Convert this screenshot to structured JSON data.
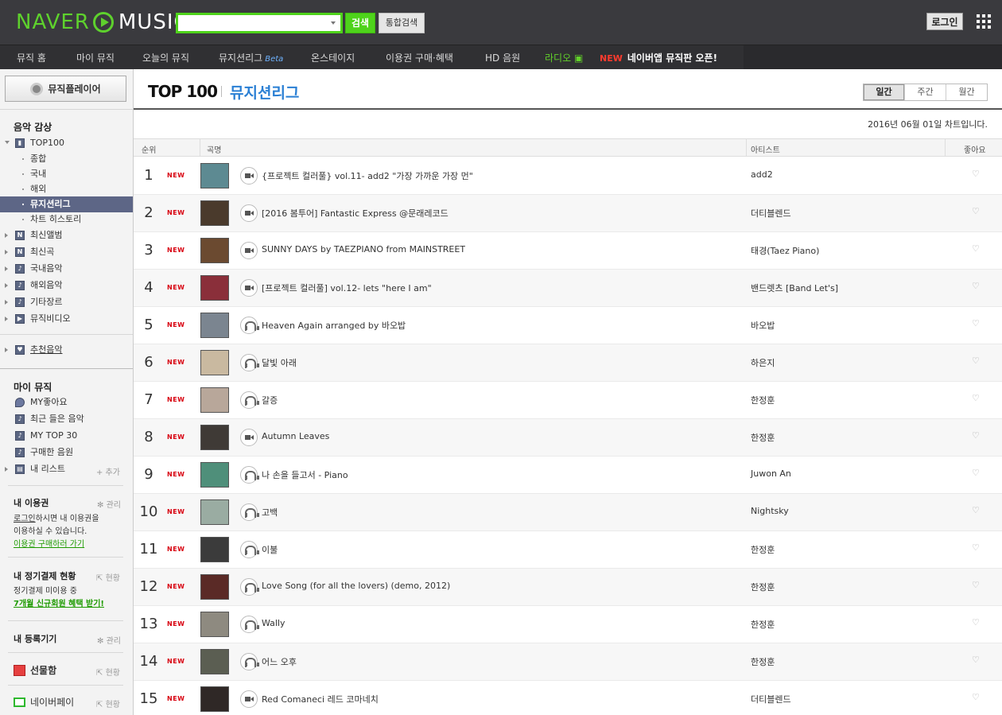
{
  "header": {
    "logo_left": "NAVER",
    "logo_right": "MUSIC",
    "search_placeholder": "",
    "search_button": "검색",
    "total_search_button": "통합검색",
    "login_button": "로그인"
  },
  "gnb": {
    "items": [
      "뮤직 홈",
      "마이 뮤직",
      "오늘의 뮤직",
      "뮤지션리그",
      "온스테이지",
      "이용권 구매·혜택",
      "HD 음원",
      "라디오"
    ],
    "beta": "Beta",
    "new_tag": "NEW",
    "notice": "네이버앱 뮤직판 오픈!"
  },
  "sidebar": {
    "player_button": "뮤직플레이어",
    "section_listen": "음악 감상",
    "top100": "TOP100",
    "top100_subs": [
      "종합",
      "국내",
      "해외",
      "뮤지션리그",
      "차트 히스토리"
    ],
    "menu": [
      "최신앨범",
      "최신곡",
      "국내음악",
      "해외음악",
      "기타장르",
      "뮤직비디오"
    ],
    "recommend": "추천음악",
    "section_my": "마이 뮤직",
    "my_items": [
      "MY좋아요",
      "최근 들은 음악",
      "MY TOP 30",
      "구매한 음원",
      "내 리스트"
    ],
    "add_label": "+ 추가",
    "my_pass_title": "내 이용권",
    "manage": "관리",
    "pass_text_login": "로그인",
    "pass_text_1": "하시면 내 이용권을",
    "pass_text_2": "이용하실 수 있습니다.",
    "pass_link": "이용권 구매하러 가기",
    "regular_title": "내 정기결제 현황",
    "status": "현황",
    "regular_text": "정기결제 미이용 중",
    "regular_link": "7개월 신규회원 혜택 받기!",
    "device_title": "내 등록기기",
    "gift": "선물함",
    "pay": "네이버페이"
  },
  "main": {
    "title_top": "TOP 100",
    "title_name": "뮤지션리그",
    "periods": [
      "일간",
      "주간",
      "월간"
    ],
    "chart_date": "2016년 06월 01일 차트입니다.",
    "columns": [
      "순위",
      "곡명",
      "아티스트",
      "좋아요"
    ],
    "new_label": "NEW",
    "rows": [
      {
        "rank": "1",
        "title": "{프로젝트 컬러풀} vol.11- add2 \"가장 가까운 가장 먼\"",
        "artist": "add2",
        "media": "video",
        "thumb": "#5d8a92"
      },
      {
        "rank": "2",
        "title": "[2016 봄투어] Fantastic Express @문래레코드",
        "artist": "더티블렌드",
        "media": "video",
        "thumb": "#4a3a2c"
      },
      {
        "rank": "3",
        "title": "SUNNY DAYS by TAEZPIANO from MAINSTREET",
        "artist": "태경(Taez Piano)",
        "media": "video",
        "thumb": "#6b4a30"
      },
      {
        "rank": "4",
        "title": "[프로젝트 컬러풀] vol.12- lets \"here I am\"",
        "artist": "밴드렛츠 [Band Let's]",
        "media": "video",
        "thumb": "#8a2f3a"
      },
      {
        "rank": "5",
        "title": "Heaven Again arranged by 바오밥",
        "artist": "바오밥",
        "media": "audio",
        "thumb": "#7b8590"
      },
      {
        "rank": "6",
        "title": "달빛 아래",
        "artist": "하은지",
        "media": "audio",
        "thumb": "#c9b9a0"
      },
      {
        "rank": "7",
        "title": "갈증",
        "artist": "한정훈",
        "media": "audio",
        "thumb": "#b8a79a"
      },
      {
        "rank": "8",
        "title": "Autumn Leaves",
        "artist": "한정훈",
        "media": "video",
        "thumb": "#3f3a36"
      },
      {
        "rank": "9",
        "title": "나 손을 들고서 - Piano",
        "artist": "Juwon An",
        "media": "audio",
        "thumb": "#4f8f7a"
      },
      {
        "rank": "10",
        "title": "고백",
        "artist": "Nightsky",
        "media": "audio",
        "thumb": "#9aaca2"
      },
      {
        "rank": "11",
        "title": "이불",
        "artist": "한정훈",
        "media": "audio",
        "thumb": "#3b3b3b"
      },
      {
        "rank": "12",
        "title": "Love Song (for all the lovers) (demo, 2012)",
        "artist": "한정훈",
        "media": "audio",
        "thumb": "#5a2a26"
      },
      {
        "rank": "13",
        "title": "Wally",
        "artist": "한정훈",
        "media": "audio",
        "thumb": "#8e8a80"
      },
      {
        "rank": "14",
        "title": "어느 오후",
        "artist": "한정훈",
        "media": "audio",
        "thumb": "#5b5e52"
      },
      {
        "rank": "15",
        "title": "Red Comaneci 레드 코마네치",
        "artist": "더티블렌드",
        "media": "video",
        "thumb": "#2f2826"
      }
    ]
  },
  "colors": {
    "brand_green": "#5ed12d",
    "accent_blue": "#2a7fd4",
    "new_red": "#d8000f",
    "active_menu": "#5d6686"
  }
}
